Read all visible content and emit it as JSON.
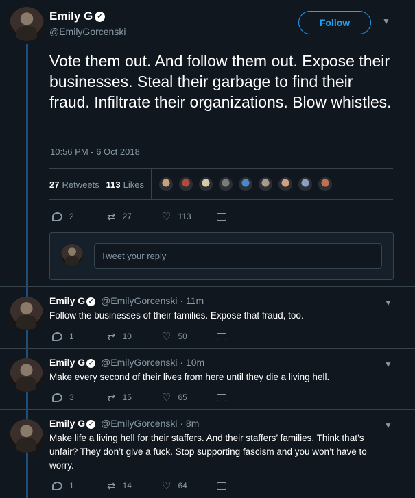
{
  "main_tweet": {
    "name": "Emily G",
    "handle": "@EmilyGorcenski",
    "follow_label": "Follow",
    "text": "Vote them out. And follow them out. Expose their businesses. Steal their garbage to find their fraud. Infiltrate their organizations. Blow whistles.",
    "timestamp": "10:56 PM - 6 Oct 2018",
    "retweets_count": "27",
    "retweets_label": "Retweets",
    "likes_count": "113",
    "likes_label": "Likes",
    "actions": {
      "replies": "2",
      "retweets": "27",
      "likes": "113"
    },
    "liker_colors": [
      "#c9a27a",
      "#b34a3a",
      "#d8c9a8",
      "#7a7a7a",
      "#4a86c8",
      "#a89a8a",
      "#d0a080",
      "#8aa0c0",
      "#c07050"
    ]
  },
  "reply_box": {
    "placeholder": "Tweet your reply"
  },
  "replies": [
    {
      "name": "Emily G",
      "meta": "@EmilyGorcenski · 11m",
      "text": "Follow the businesses of their families. Expose that fraud, too.",
      "replies": "1",
      "retweets": "10",
      "likes": "50"
    },
    {
      "name": "Emily G",
      "meta": "@EmilyGorcenski · 10m",
      "text": "Make every second of their lives from here until they die a living hell.",
      "replies": "3",
      "retweets": "15",
      "likes": "65"
    },
    {
      "name": "Emily G",
      "meta": "@EmilyGorcenski · 8m",
      "text": "Make life a living hell for their staffers. And their staffers’ families. Think that’s unfair? They don’t give a fuck. Stop supporting fascism and you won’t have to worry.",
      "replies": "1",
      "retweets": "14",
      "likes": "64"
    }
  ],
  "icons": {
    "reply": "reply-bubble-icon",
    "retweet": "retweet-icon",
    "like": "heart-icon",
    "dm": "envelope-icon",
    "caret": "chevron-down-icon",
    "verified": "verified-badge-icon"
  },
  "colors": {
    "background": "#10171e",
    "accent": "#1da1f2",
    "muted": "#8899a6",
    "thread_line": "#1c4f7c"
  }
}
